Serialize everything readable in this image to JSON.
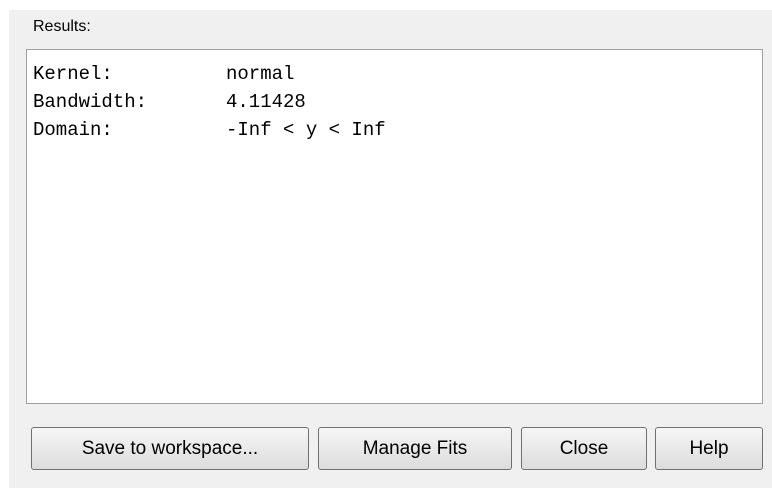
{
  "results_label": "Results:",
  "results": [
    {
      "key": "Kernel:",
      "value": "normal"
    },
    {
      "key": "Bandwidth:",
      "value": "4.11428"
    },
    {
      "key": "Domain:",
      "value": "-Inf < y < Inf"
    }
  ],
  "buttons": {
    "save": "Save to workspace...",
    "manage": "Manage Fits",
    "close": "Close",
    "help": "Help"
  }
}
